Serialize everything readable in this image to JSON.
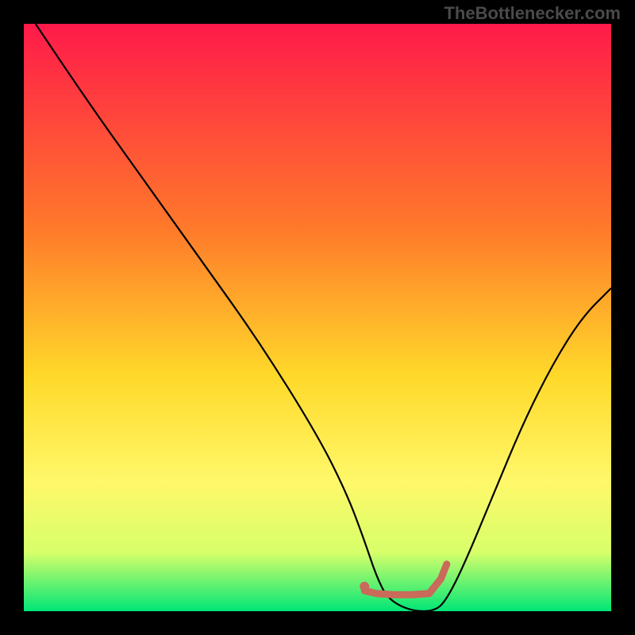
{
  "watermark": "TheBottlenecker.com",
  "chart_data": {
    "type": "line",
    "title": "",
    "xlabel": "",
    "ylabel": "",
    "xlim": [
      0,
      100
    ],
    "ylim": [
      0,
      100
    ],
    "gradient_stops": [
      {
        "offset": 0,
        "color": "#ff1a4a"
      },
      {
        "offset": 35,
        "color": "#ff7a2a"
      },
      {
        "offset": 60,
        "color": "#ffd92a"
      },
      {
        "offset": 78,
        "color": "#fff86a"
      },
      {
        "offset": 90,
        "color": "#d7ff6a"
      },
      {
        "offset": 100,
        "color": "#00e676"
      }
    ],
    "series": [
      {
        "name": "bottleneck-curve",
        "color": "#000000",
        "x": [
          2,
          10,
          20,
          30,
          40,
          50,
          55,
          58,
          60,
          62,
          66,
          70,
          72,
          75,
          80,
          85,
          90,
          95,
          100
        ],
        "y": [
          100,
          88,
          74,
          60,
          46,
          30,
          20,
          12,
          6,
          2,
          0,
          0,
          2,
          8,
          20,
          32,
          42,
          50,
          55
        ]
      }
    ],
    "marker_segment": {
      "color": "#c96a5a",
      "x": [
        58,
        60,
        63,
        66,
        69,
        71,
        72
      ],
      "y": [
        3.5,
        3.0,
        2.8,
        2.8,
        3.0,
        5.5,
        8.0
      ],
      "dot": {
        "x": 58,
        "y": 4.2
      }
    }
  }
}
